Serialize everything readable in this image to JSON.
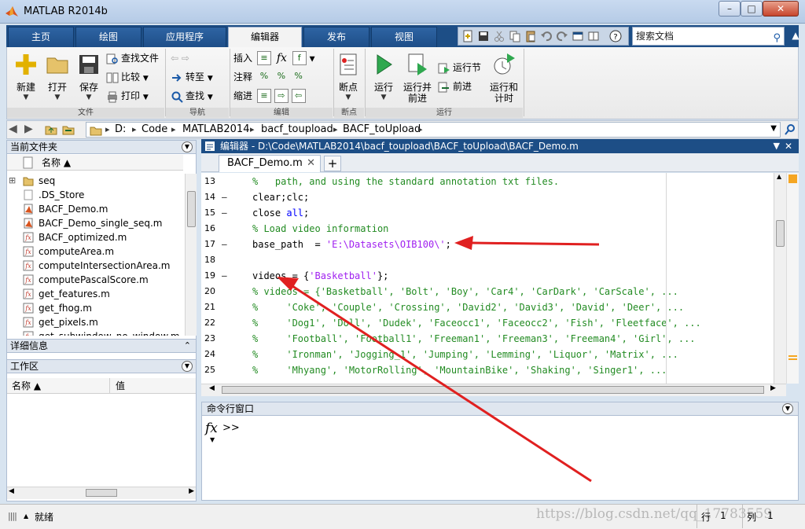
{
  "window": {
    "title": "MATLAB R2014b"
  },
  "tabs": [
    {
      "label": "主页"
    },
    {
      "label": "绘图"
    },
    {
      "label": "应用程序"
    },
    {
      "label": "编辑器"
    },
    {
      "label": "发布"
    },
    {
      "label": "视图"
    }
  ],
  "search": {
    "placeholder": "搜索文档"
  },
  "ribbon": {
    "file": {
      "title": "文件",
      "new": "新建",
      "open": "打开",
      "save": "保存",
      "find_files": "查找文件",
      "compare": "比较",
      "print": "打印"
    },
    "navigate": {
      "title": "导航",
      "goto": "转至",
      "find": "查找"
    },
    "edit": {
      "title": "编辑",
      "insert": "插入",
      "comment": "注释",
      "indent": "缩进",
      "fx": "fx"
    },
    "breakpoints": {
      "title": "断点",
      "breakpoints": "断点"
    },
    "run": {
      "title": "运行",
      "run": "运行",
      "run_advance": "运行并\n前进",
      "run_section": "运行节",
      "advance": "前进",
      "run_time": "运行和\n计时"
    }
  },
  "path": {
    "crumbs": [
      "D:",
      "Code",
      "MATLAB2014",
      "bacf_toupload",
      "BACF_toUpload"
    ]
  },
  "current_folder": {
    "title": "当前文件夹",
    "column": "名称 ▲",
    "files": [
      {
        "name": "seq",
        "type": "folder"
      },
      {
        "name": ".DS_Store",
        "type": "file"
      },
      {
        "name": "BACF_Demo.m",
        "type": "m"
      },
      {
        "name": "BACF_Demo_single_seq.m",
        "type": "m"
      },
      {
        "name": "BACF_optimized.m",
        "type": "fx"
      },
      {
        "name": "computeArea.m",
        "type": "fx"
      },
      {
        "name": "computeIntersectionArea.m",
        "type": "fx"
      },
      {
        "name": "computePascalScore.m",
        "type": "fx"
      },
      {
        "name": "get_features.m",
        "type": "fx"
      },
      {
        "name": "get_fhog.m",
        "type": "fx"
      },
      {
        "name": "get_pixels.m",
        "type": "fx"
      },
      {
        "name": "get_subwindow_no_window.m",
        "type": "fx"
      }
    ]
  },
  "details": {
    "title": "详细信息"
  },
  "workspace": {
    "title": "工作区",
    "col_name": "名称 ▲",
    "col_value": "值"
  },
  "editor": {
    "title": "编辑器 - D:\\Code\\MATLAB2014\\bacf_toupload\\BACF_toUpload\\BACF_Demo.m",
    "tab": "BACF_Demo.m",
    "lines": [
      {
        "n": "13",
        "dash": "",
        "segments": [
          {
            "c": "cm",
            "t": "%   path, and using the standard annotation txt files."
          }
        ]
      },
      {
        "n": "14",
        "dash": "—",
        "segments": [
          {
            "c": "",
            "t": "clear;clc;"
          }
        ]
      },
      {
        "n": "15",
        "dash": "—",
        "segments": [
          {
            "c": "",
            "t": "close "
          },
          {
            "c": "kw",
            "t": "all"
          },
          {
            "c": "",
            "t": ";"
          }
        ]
      },
      {
        "n": "16",
        "dash": "",
        "segments": [
          {
            "c": "cm",
            "t": "% Load video information"
          }
        ]
      },
      {
        "n": "17",
        "dash": "—",
        "segments": [
          {
            "c": "",
            "t": "base_path  = "
          },
          {
            "c": "str",
            "t": "'E:\\Datasets\\OIB100\\'"
          },
          {
            "c": "",
            "t": ";"
          }
        ]
      },
      {
        "n": "18",
        "dash": "",
        "segments": []
      },
      {
        "n": "19",
        "dash": "—",
        "segments": [
          {
            "c": "",
            "t": "videos = {"
          },
          {
            "c": "str",
            "t": "'Basketball'"
          },
          {
            "c": "",
            "t": "};"
          }
        ]
      },
      {
        "n": "20",
        "dash": "",
        "segments": [
          {
            "c": "cm",
            "t": "% videos = {'Basketball', 'Bolt', 'Boy', 'Car4', 'CarDark', 'CarScale', ..."
          }
        ]
      },
      {
        "n": "21",
        "dash": "",
        "segments": [
          {
            "c": "cm",
            "t": "%     'Coke', 'Couple', 'Crossing', 'David2', 'David3', 'David', 'Deer', ..."
          }
        ]
      },
      {
        "n": "22",
        "dash": "",
        "segments": [
          {
            "c": "cm",
            "t": "%     'Dog1', 'Doll', 'Dudek', 'Faceocc1', 'Faceocc2', 'Fish', 'Fleetface', ..."
          }
        ]
      },
      {
        "n": "23",
        "dash": "",
        "segments": [
          {
            "c": "cm",
            "t": "%     'Football', 'Football1', 'Freeman1', 'Freeman3', 'Freeman4', 'Girl', ..."
          }
        ]
      },
      {
        "n": "24",
        "dash": "",
        "segments": [
          {
            "c": "cm",
            "t": "%     'Ironman', 'Jogging_1', 'Jumping', 'Lemming', 'Liquor', 'Matrix', ..."
          }
        ]
      },
      {
        "n": "25",
        "dash": "",
        "segments": [
          {
            "c": "cm",
            "t": "%     'Mhyang', 'MotorRolling', 'MountainBike', 'Shaking', 'Singer1', ..."
          }
        ]
      }
    ]
  },
  "command_window": {
    "title": "命令行窗口",
    "prompt": ">>",
    "fx": "fx"
  },
  "status": {
    "text": "就绪",
    "row_label": "行",
    "row": "1",
    "col_label": "列",
    "col": "1",
    "watermark": "https://blog.csdn.net/qq_17783559"
  },
  "colors": {
    "title_blue": "#1d4e86",
    "arrow_red": "#e02020",
    "comment_green": "#228b22",
    "string_purple": "#a020f0",
    "keyword_blue": "#0000ff"
  }
}
